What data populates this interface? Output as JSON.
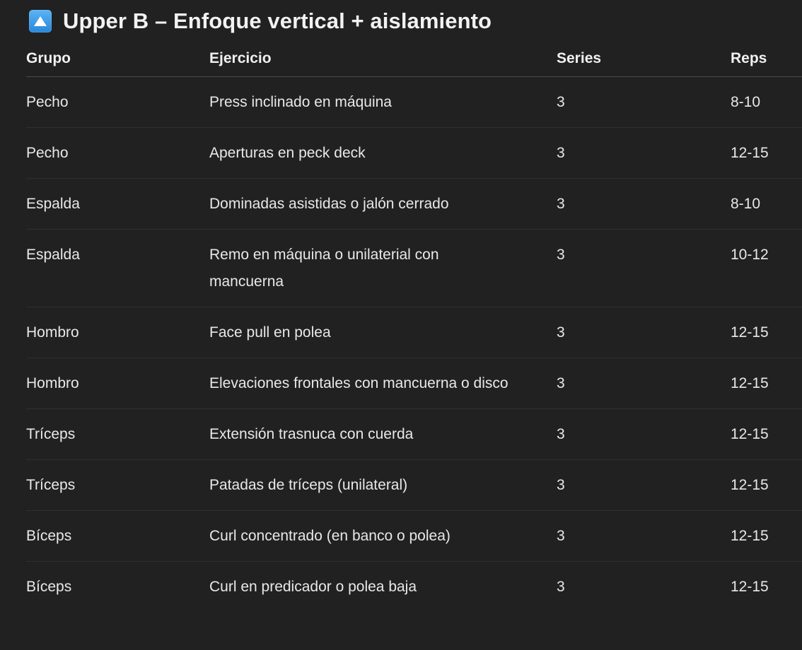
{
  "heading": {
    "icon": "up-arrow-button-icon",
    "title": "Upper B – Enfoque vertical + aislamiento"
  },
  "table": {
    "headers": [
      "Grupo",
      "Ejercicio",
      "Series",
      "Reps"
    ],
    "rows": [
      [
        "Pecho",
        "Press inclinado en máquina",
        "3",
        "8-10"
      ],
      [
        "Pecho",
        "Aperturas en peck deck",
        "3",
        "12-15"
      ],
      [
        "Espalda",
        "Dominadas asistidas o jalón cerrado",
        "3",
        "8-10"
      ],
      [
        "Espalda",
        "Remo en máquina o unilaterial con mancuerna",
        "3",
        "10-12"
      ],
      [
        "Hombro",
        "Face pull en polea",
        "3",
        "12-15"
      ],
      [
        "Hombro",
        "Elevaciones frontales con mancuerna o disco",
        "3",
        "12-15"
      ],
      [
        "Tríceps",
        "Extensión trasnuca con cuerda",
        "3",
        "12-15"
      ],
      [
        "Tríceps",
        "Patadas de tríceps (unilateral)",
        "3",
        "12-15"
      ],
      [
        "Bíceps",
        "Curl concentrado (en banco o polea)",
        "3",
        "12-15"
      ],
      [
        "Bíceps",
        "Curl en predicador o polea baja",
        "3",
        "12-15"
      ]
    ]
  },
  "colors": {
    "background": "#212121",
    "text": "#ececec",
    "icon": "#3b9cf0"
  }
}
